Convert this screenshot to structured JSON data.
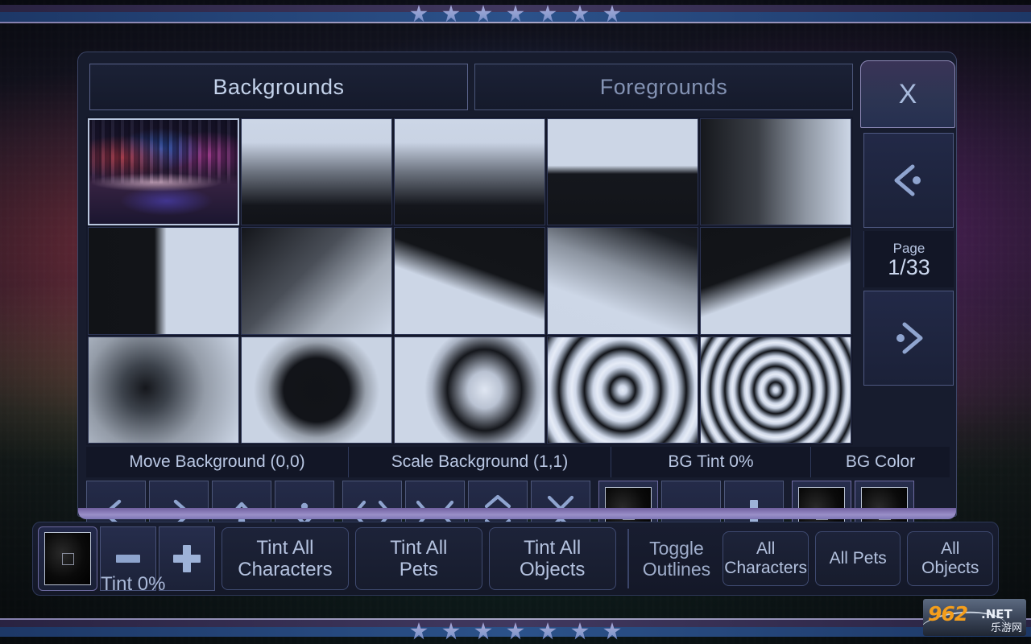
{
  "tabs": [
    {
      "label": "Backgrounds",
      "active": true
    },
    {
      "label": "Foregrounds",
      "active": false
    }
  ],
  "close_button": {
    "label": "X",
    "icon": "close-icon"
  },
  "pager": {
    "prev_icon": "chevron-left-dot-icon",
    "next_icon": "chevron-right-dot-icon",
    "page_word": "Page",
    "page_value": "1/33"
  },
  "grid": {
    "columns": 5,
    "rows": 3,
    "items": [
      {
        "name": "neon-city-skyline",
        "art": "art-city",
        "selected": true
      },
      {
        "name": "vertical-fade-white-black",
        "art": "art-g1",
        "selected": false
      },
      {
        "name": "horizon-split-soft",
        "art": "art-g2",
        "selected": false
      },
      {
        "name": "horizon-split-hard",
        "art": "art-g4",
        "selected": false
      },
      {
        "name": "horizontal-fade-dark-light",
        "art": "art-g3",
        "selected": false
      },
      {
        "name": "vertical-split-half",
        "art": "art-g4",
        "selected": false
      },
      {
        "name": "diagonal-fade-corner",
        "art": "art-g5",
        "selected": false
      },
      {
        "name": "diagonal-wedge-up",
        "art": "art-g6",
        "selected": false
      },
      {
        "name": "diagonal-fade-reverse",
        "art": "art-g7",
        "selected": false
      },
      {
        "name": "diagonal-wedge-down",
        "art": "art-g8",
        "selected": false
      },
      {
        "name": "radial-dark-center",
        "art": "art-r1",
        "selected": false
      },
      {
        "name": "radial-dark-blob",
        "art": "art-r2",
        "selected": false
      },
      {
        "name": "radial-light-center",
        "art": "art-r3",
        "selected": false
      },
      {
        "name": "concentric-rings-wide",
        "art": "art-ring1",
        "selected": false
      },
      {
        "name": "concentric-rings-tight",
        "art": "art-ring2",
        "selected": false
      }
    ]
  },
  "controls": {
    "move": {
      "header": "Move Background (0,0)",
      "buttons": [
        {
          "name": "move-left-button",
          "icon": "chevron-left-dot-icon"
        },
        {
          "name": "move-right-button",
          "icon": "chevron-right-dot-icon"
        },
        {
          "name": "move-up-button",
          "icon": "chevron-up-dot-icon"
        },
        {
          "name": "move-down-button",
          "icon": "chevron-down-dot-icon"
        }
      ]
    },
    "scale": {
      "header": "Scale Background (1,1)",
      "buttons": [
        {
          "name": "scale-wider-button",
          "icon": "expand-horizontal-icon"
        },
        {
          "name": "scale-narrower-button",
          "icon": "collapse-horizontal-icon"
        },
        {
          "name": "scale-taller-button",
          "icon": "expand-vertical-icon"
        },
        {
          "name": "scale-shorter-button",
          "icon": "collapse-vertical-icon"
        }
      ]
    },
    "bg_tint": {
      "header": "BG Tint 0%",
      "swatch_color": "#000000",
      "minus_label": "-",
      "plus_label": "+"
    },
    "bg_color": {
      "header": "BG Color",
      "swatch_1_color": "#000000",
      "swatch_2_color": "#000000"
    }
  },
  "bottom_bar": {
    "tint_swatch_color": "#000000",
    "tint_minus_label": "-",
    "tint_plus_label": "+",
    "tint_percent_label": "Tint 0%",
    "tint_all_characters": {
      "line1": "Tint All",
      "line2": "Characters"
    },
    "tint_all_pets": {
      "line1": "Tint All",
      "line2": "Pets"
    },
    "tint_all_objects": {
      "line1": "Tint All",
      "line2": "Objects"
    },
    "toggle_outlines": {
      "line1": "Toggle",
      "line2": "Outlines"
    },
    "all_characters": {
      "line1": "All",
      "line2": "Characters"
    },
    "all_pets": {
      "line1": "All Pets",
      "line2": ""
    },
    "all_objects": {
      "line1": "All",
      "line2": "Objects"
    }
  },
  "watermark": {
    "brand": "962",
    "tld": ".NET",
    "cn": "乐游网"
  },
  "colors": {
    "accent": "#8ea4cd",
    "panel_bg": "#171c2e",
    "panel_border": "#3c4566",
    "text": "#b9c7e3",
    "sheen": "#9a8fc8"
  }
}
